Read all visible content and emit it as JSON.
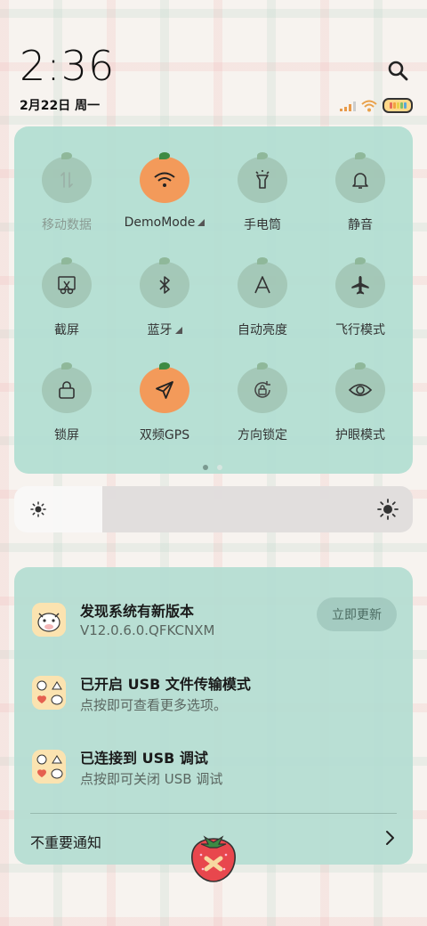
{
  "status": {
    "time": "2:36",
    "date": "2月22日 周一"
  },
  "quick_settings": {
    "tiles": [
      {
        "label": "移动数据",
        "icon": "mobile-data-icon",
        "active": false,
        "dim": true
      },
      {
        "label": "DemoMode",
        "icon": "wifi-icon",
        "active": true,
        "dim": false
      },
      {
        "label": "手电筒",
        "icon": "flashlight-icon",
        "active": false,
        "dim": false
      },
      {
        "label": "静音",
        "icon": "bell-icon",
        "active": false,
        "dim": false
      },
      {
        "label": "截屏",
        "icon": "screenshot-icon",
        "active": false,
        "dim": false
      },
      {
        "label": "蓝牙",
        "icon": "bluetooth-icon",
        "active": false,
        "dim": false
      },
      {
        "label": "自动亮度",
        "icon": "auto-brightness-icon",
        "active": false,
        "dim": false
      },
      {
        "label": "飞行模式",
        "icon": "airplane-icon",
        "active": false,
        "dim": false
      },
      {
        "label": "锁屏",
        "icon": "lock-icon",
        "active": false,
        "dim": false
      },
      {
        "label": "双频GPS",
        "icon": "gps-icon",
        "active": true,
        "dim": false
      },
      {
        "label": "方向锁定",
        "icon": "rotation-lock-icon",
        "active": false,
        "dim": false
      },
      {
        "label": "护眼模式",
        "icon": "eye-icon",
        "active": false,
        "dim": false
      }
    ],
    "page": 1,
    "pages": 2
  },
  "brightness": {
    "level": 0.22
  },
  "notifications": [
    {
      "title": "发现系统有新版本",
      "subtitle": "V12.0.6.0.QFKCNXM",
      "action": "立即更新"
    },
    {
      "title": "已开启 USB 文件传输模式",
      "subtitle": "点按即可查看更多选项。"
    },
    {
      "title": "已连接到 USB 调试",
      "subtitle": "点按即可关闭 USB 调试"
    }
  ],
  "minor_notifications": {
    "label": "不重要通知"
  },
  "colors": {
    "accent": "#f39a5a",
    "panel": "#b2ded2"
  }
}
